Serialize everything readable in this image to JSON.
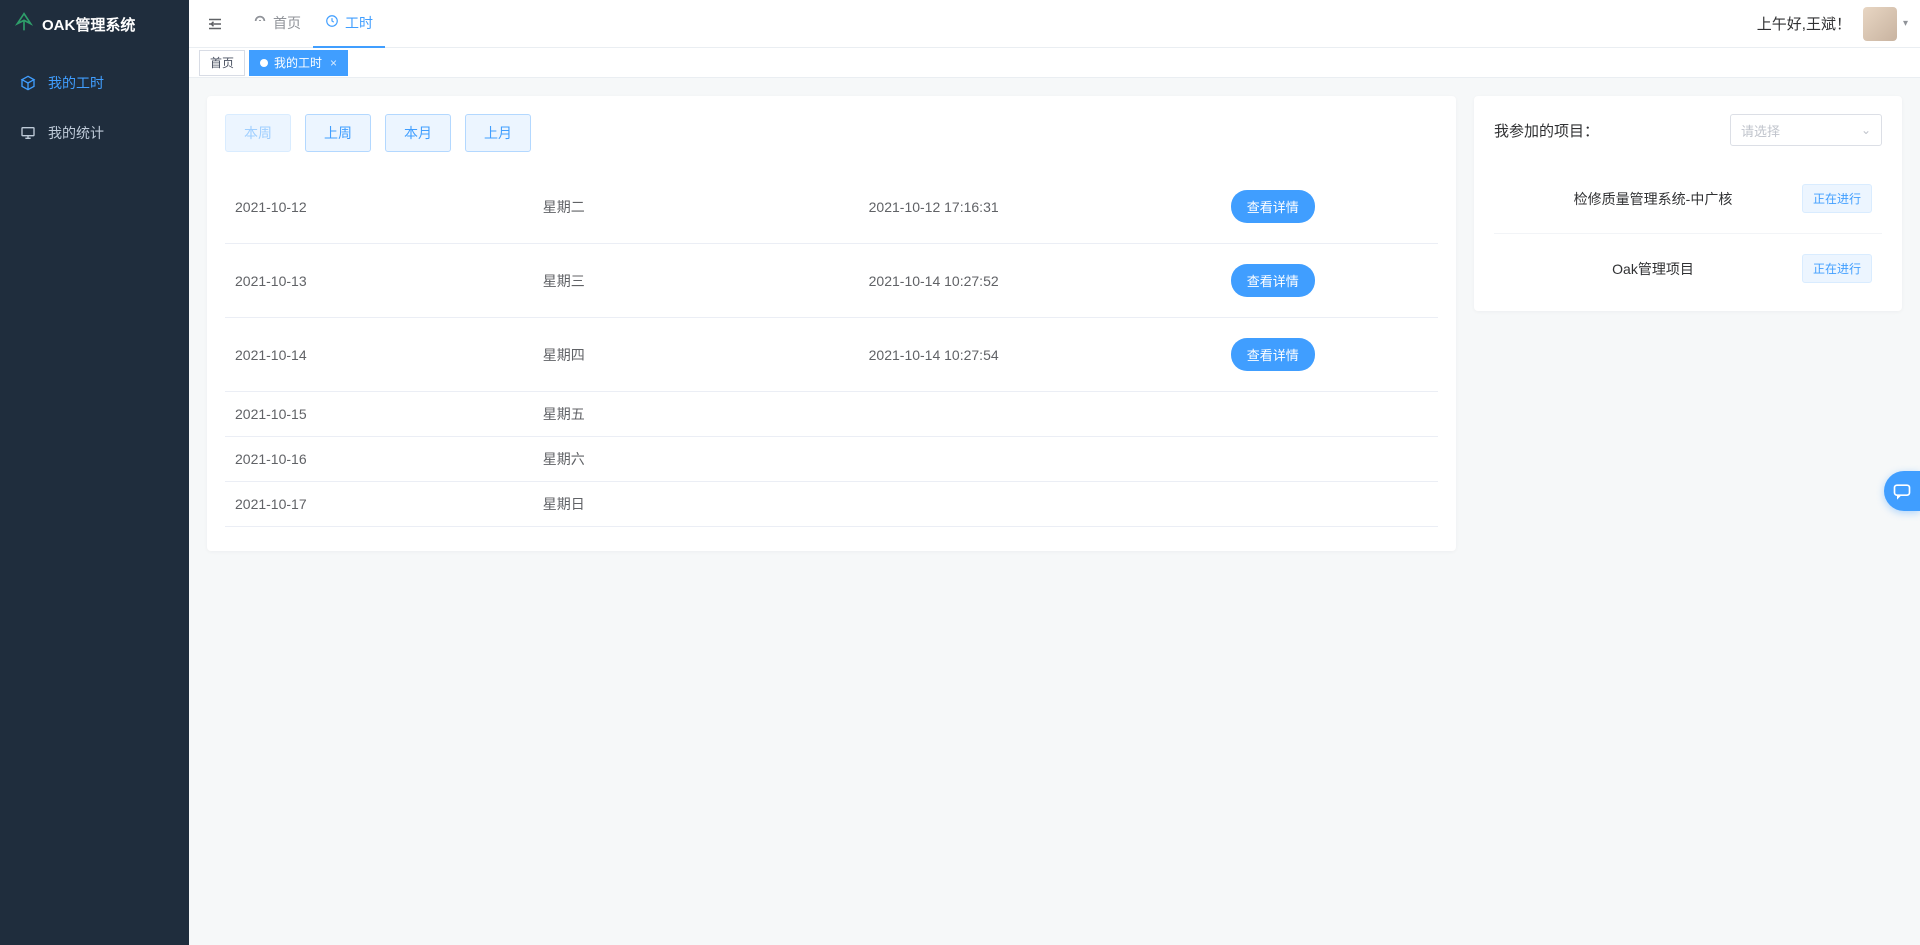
{
  "app": {
    "title": "OAK管理系统"
  },
  "sidebar": {
    "items": [
      {
        "label": "我的工时",
        "active": true
      },
      {
        "label": "我的统计",
        "active": false
      }
    ]
  },
  "topnav": {
    "items": [
      {
        "label": "首页",
        "active": false
      },
      {
        "label": "工时",
        "active": true
      }
    ]
  },
  "greeting": "上午好,王斌！",
  "tabs": {
    "items": [
      {
        "label": "首页",
        "active": false,
        "closable": false
      },
      {
        "label": "我的工时",
        "active": true,
        "closable": true
      }
    ]
  },
  "range": {
    "buttons": [
      {
        "label": "本周",
        "active": true
      },
      {
        "label": "上周",
        "active": false
      },
      {
        "label": "本月",
        "active": false
      },
      {
        "label": "上月",
        "active": false
      }
    ]
  },
  "table": {
    "detail_label": "查看详情",
    "rows": [
      {
        "date": "2021-10-12",
        "day": "星期二",
        "timestamp": "2021-10-12 17:16:31",
        "has_detail": true
      },
      {
        "date": "2021-10-13",
        "day": "星期三",
        "timestamp": "2021-10-14 10:27:52",
        "has_detail": true
      },
      {
        "date": "2021-10-14",
        "day": "星期四",
        "timestamp": "2021-10-14 10:27:54",
        "has_detail": true
      },
      {
        "date": "2021-10-15",
        "day": "星期五",
        "timestamp": "",
        "has_detail": false
      },
      {
        "date": "2021-10-16",
        "day": "星期六",
        "timestamp": "",
        "has_detail": false
      },
      {
        "date": "2021-10-17",
        "day": "星期日",
        "timestamp": "",
        "has_detail": false
      }
    ]
  },
  "panel": {
    "title": "我参加的项目：",
    "select_placeholder": "请选择",
    "status_label": "正在进行",
    "projects": [
      {
        "name": "检修质量管理系统-中广核"
      },
      {
        "name": "Oak管理项目"
      }
    ]
  }
}
